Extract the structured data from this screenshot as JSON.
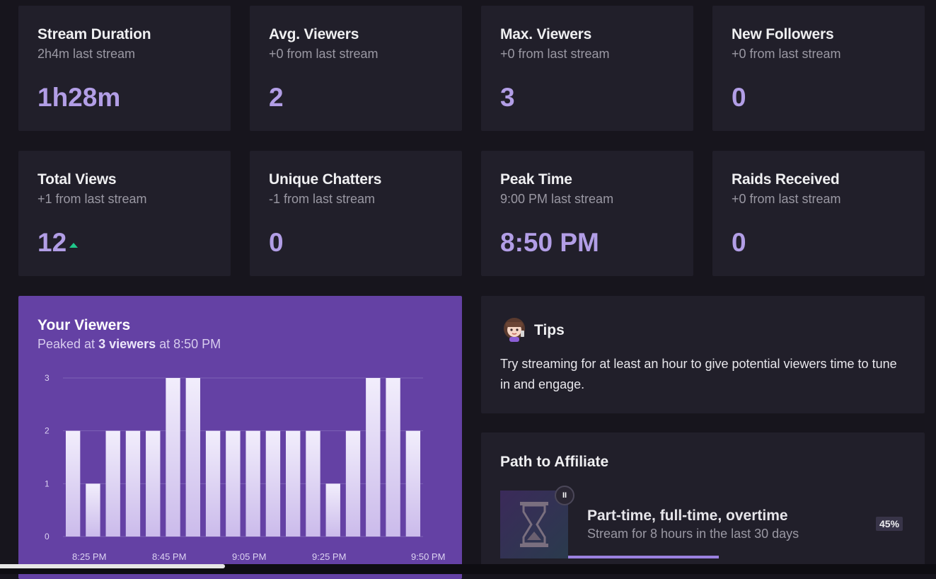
{
  "stats": [
    {
      "title": "Stream Duration",
      "sub": "2h4m last stream",
      "value": "1h28m"
    },
    {
      "title": "Avg. Viewers",
      "sub": "+0 from last stream",
      "value": "2"
    },
    {
      "title": "Max. Viewers",
      "sub": "+0 from last stream",
      "value": "3"
    },
    {
      "title": "New Followers",
      "sub": "+0 from last stream",
      "value": "0"
    },
    {
      "title": "Total Views",
      "sub": "+1 from last stream",
      "value": "12",
      "trend": "up"
    },
    {
      "title": "Unique Chatters",
      "sub": "-1 from last stream",
      "value": "0"
    },
    {
      "title": "Peak Time",
      "sub": "9:00 PM last stream",
      "value": "8:50 PM"
    },
    {
      "title": "Raids Received",
      "sub": "+0 from last stream",
      "value": "0"
    }
  ],
  "viewers": {
    "title": "Your Viewers",
    "sub_prefix": "Peaked at ",
    "sub_bold": "3 viewers",
    "sub_suffix": " at 8:50 PM"
  },
  "chart_data": {
    "type": "bar",
    "values": [
      2,
      1,
      2,
      2,
      2,
      3,
      3,
      2,
      2,
      2,
      2,
      2,
      2,
      1,
      2,
      3,
      3,
      2
    ],
    "yticks": [
      "0",
      "1",
      "2",
      "3"
    ],
    "ylim": [
      0,
      3
    ],
    "xticks": [
      "8:25 PM",
      "8:45 PM",
      "9:05 PM",
      "9:25 PM",
      "9:50 PM"
    ],
    "grid": true,
    "bar_color_top": "#f2eefc",
    "bar_color_bottom": "#cbbbeb"
  },
  "tips": {
    "title": "Tips",
    "text": "Try streaming for at least an hour to give potential viewers time to tune in and engage."
  },
  "affiliate": {
    "title": "Path to Affiliate",
    "goal_title": "Part-time, full-time, overtime",
    "goal_sub": "Stream for 8 hours in the last 30 days",
    "progress_label": "45%",
    "progress": 0.45,
    "pause_glyph": "II"
  },
  "colors": {
    "accent": "#6441a4",
    "value": "#b29ee6",
    "trend_up": "#1fc88b"
  }
}
